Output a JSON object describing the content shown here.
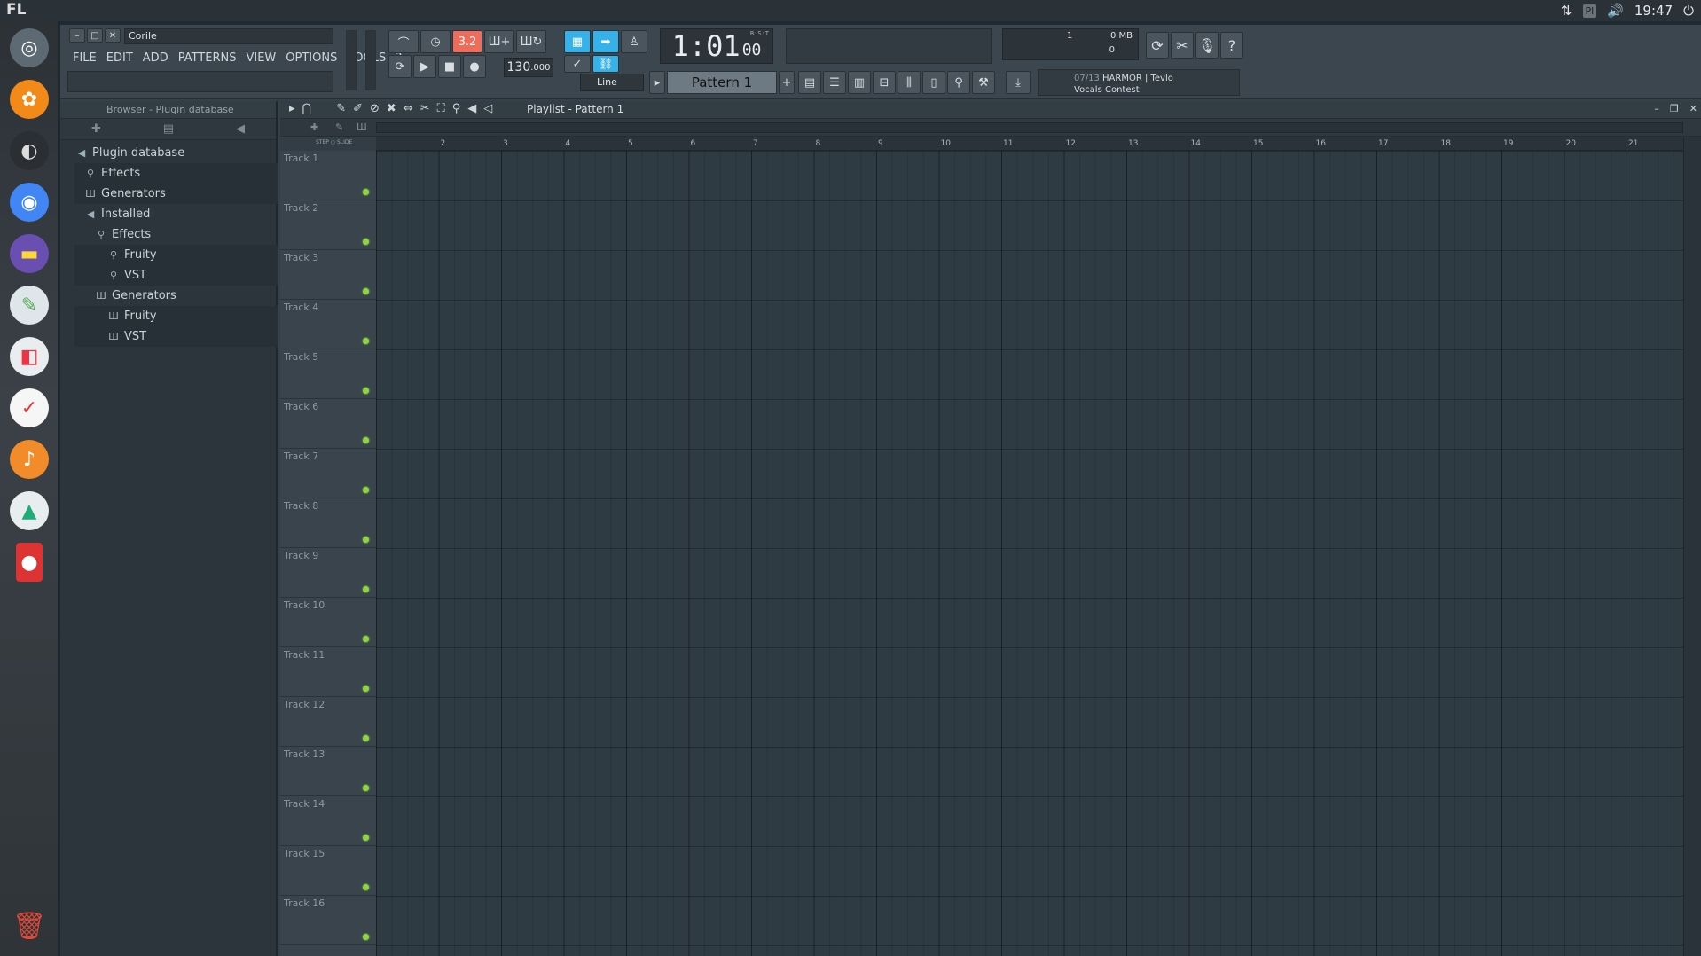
{
  "os": {
    "logo": "FL",
    "clock": "19:47",
    "kbd": "Pl"
  },
  "window": {
    "project_title": "Corile"
  },
  "menu": [
    "FILE",
    "EDIT",
    "ADD",
    "PATTERNS",
    "VIEW",
    "OPTIONS",
    "TOOLS",
    "?"
  ],
  "transport": {
    "time_main": "1:01",
    "time_sub": "00",
    "time_label": "B:S:T",
    "tempo_main": "130",
    "tempo_sub": ".000",
    "pattern": "Pattern 1",
    "snap": "Line",
    "counter": "3.2"
  },
  "cpu": {
    "mem": "0 MB",
    "voices": "1",
    "poly": "0"
  },
  "news": {
    "counter": "07/13",
    "line1": "HARMOR | Tevlo",
    "line2": "Vocals Contest"
  },
  "browser": {
    "header": "Browser - Plugin database",
    "items": [
      {
        "label": "Plugin database",
        "level": 0,
        "icon": "speaker-icon"
      },
      {
        "label": "Effects",
        "level": 1,
        "icon": "plug-icon"
      },
      {
        "label": "Generators",
        "level": 1,
        "icon": "piano-icon"
      },
      {
        "label": "Installed",
        "level": 1,
        "icon": "speaker-icon"
      },
      {
        "label": "Effects",
        "level": 2,
        "icon": "plug-icon"
      },
      {
        "label": "Fruity",
        "level": 3,
        "icon": "plug-icon"
      },
      {
        "label": "VST",
        "level": 3,
        "icon": "plug-icon"
      },
      {
        "label": "Generators",
        "level": 2,
        "icon": "piano-icon"
      },
      {
        "label": "Fruity",
        "level": 3,
        "icon": "piano-icon"
      },
      {
        "label": "VST",
        "level": 3,
        "icon": "piano-icon"
      }
    ]
  },
  "playlist": {
    "title": "Playlist - Pattern 1",
    "step_label": "STEP",
    "slide_label": "SLIDE",
    "bars": [
      "2",
      "3",
      "4",
      "5",
      "6",
      "7",
      "8",
      "9",
      "10",
      "11",
      "12",
      "13",
      "14",
      "15",
      "16",
      "17",
      "18",
      "19",
      "20",
      "21"
    ],
    "tracks": [
      "Track 1",
      "Track 2",
      "Track 3",
      "Track 4",
      "Track 5",
      "Track 6",
      "Track 7",
      "Track 8",
      "Track 9",
      "Track 10",
      "Track 11",
      "Track 12",
      "Track 13",
      "Track 14",
      "Track 15",
      "Track 16"
    ]
  },
  "dock_apps": [
    "ubuntu-logo-icon",
    "fl-studio-icon",
    "obs-icon",
    "chromium-icon",
    "files-icon",
    "gimp-icon",
    "toggle-app-icon",
    "notes-icon",
    "audacity-icon",
    "inkscape-icon",
    "recorder-icon",
    "trash-icon"
  ],
  "colors": {
    "accent_blue": "#36b2ea",
    "record_red": "#ef6b5a",
    "led_green": "#98d046"
  }
}
